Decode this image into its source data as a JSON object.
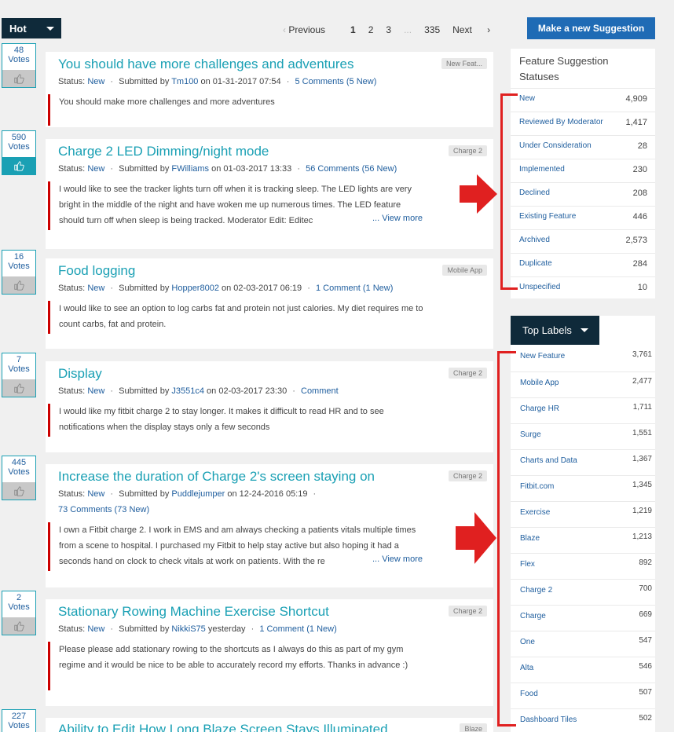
{
  "sort": {
    "label": "Hot"
  },
  "pagination": {
    "previous": "Previous",
    "pages": [
      "1",
      "2",
      "3"
    ],
    "ellipsis": "...",
    "last": "335",
    "next": "Next"
  },
  "suggest_button": "Make a new Suggestion",
  "posts": [
    {
      "votes": "48",
      "votes_label": "Votes",
      "title": "You should have more challenges and adventures",
      "tag": "New Feat...",
      "status_label": "Status:",
      "status": "New",
      "submitted_by": "Submitted by",
      "user": "Tm100",
      "date": "on 01-31-2017 07:54",
      "comments": "5 Comments (5 New)",
      "body": "You should make more challenges and more adventures"
    },
    {
      "votes": "590",
      "votes_label": "Votes",
      "title": "Charge 2 LED Dimming/night mode",
      "tag": "Charge 2",
      "status_label": "Status:",
      "status": "New",
      "submitted_by": "Submitted by",
      "user": "FWilliams",
      "date": "on 01-03-2017 13:33",
      "comments": "56 Comments (56 New)",
      "body": "I would like to see the tracker lights turn off when it is tracking sleep. The LED lights are very bright in the middle of the night and have woken me up numerous times. The LED feature should turn off when sleep is being tracked.    Moderator Edit: Editec",
      "more": "... View more"
    },
    {
      "votes": "16",
      "votes_label": "Votes",
      "title": "Food logging",
      "tag": "Mobile App",
      "status_label": "Status:",
      "status": "New",
      "submitted_by": "Submitted by",
      "user": "Hopper8002",
      "date": "on 02-03-2017 06:19",
      "comments": "1 Comment (1 New)",
      "body": "I would like to see an option to log carbs fat and protein not just calories. My diet requires me to count carbs, fat and protein."
    },
    {
      "votes": "7",
      "votes_label": "Votes",
      "title": "Display",
      "tag": "Charge 2",
      "status_label": "Status:",
      "status": "New",
      "submitted_by": "Submitted by",
      "user": "J3551c4",
      "date": "on 02-03-2017 23:30",
      "comments": "Comment",
      "body": "I would like my fitbit charge 2 to stay longer. It makes it difficult to read HR and to see notifications when the display stays only a few seconds"
    },
    {
      "votes": "445",
      "votes_label": "Votes",
      "title": "Increase the duration of Charge 2's screen staying on",
      "tag": "Charge 2",
      "status_label": "Status:",
      "status": "New",
      "submitted_by": "Submitted by",
      "user": "Puddlejumper",
      "date": "on 12-24-2016 05:19",
      "comments": "73 Comments (73 New)",
      "body": "I own a Fitbit charge 2. I work in EMS and am always checking a patients vitals multiple times from a scene to hospital. I purchased my Fitbit to help stay active but also hoping it had a seconds hand on clock to check vitals at work on patients. With the re",
      "more": "... View more"
    },
    {
      "votes": "2",
      "votes_label": "Votes",
      "title": "Stationary Rowing Machine Exercise Shortcut",
      "tag": "Charge 2",
      "status_label": "Status:",
      "status": "New",
      "submitted_by": "Submitted by",
      "user": "NikkiS75",
      "date": "yesterday",
      "comments": "1 Comment (1 New)",
      "body": "Please please add stationary rowing to the shortcuts as I always do this as part of my gym regime and it would be nice to be able to accurately record my efforts. Thanks in advance :)"
    },
    {
      "votes": "227",
      "votes_label": "Votes",
      "title": "Ability to Edit How Long Blaze Screen Stays Illuminated",
      "tag": "Blaze"
    }
  ],
  "statuses": {
    "title": "Feature Suggestion Statuses",
    "items": [
      {
        "name": "New",
        "count": "4,909"
      },
      {
        "name": "Reviewed By Moderator",
        "count": "1,417"
      },
      {
        "name": "Under Consideration",
        "count": "28"
      },
      {
        "name": "Implemented",
        "count": "230"
      },
      {
        "name": "Declined",
        "count": "208"
      },
      {
        "name": "Existing Feature",
        "count": "446"
      },
      {
        "name": "Archived",
        "count": "2,573"
      },
      {
        "name": "Duplicate",
        "count": "284"
      },
      {
        "name": "Unspecified",
        "count": "10"
      }
    ]
  },
  "labels": {
    "title": "Top Labels",
    "items": [
      {
        "name": "New Feature",
        "count": "3,761"
      },
      {
        "name": "Mobile App",
        "count": "2,477"
      },
      {
        "name": "Charge HR",
        "count": "1,711"
      },
      {
        "name": "Surge",
        "count": "1,551"
      },
      {
        "name": "Charts and Data",
        "count": "1,367"
      },
      {
        "name": "Fitbit.com",
        "count": "1,345"
      },
      {
        "name": "Exercise",
        "count": "1,219"
      },
      {
        "name": "Blaze",
        "count": "1,213"
      },
      {
        "name": "Flex",
        "count": "892"
      },
      {
        "name": "Charge 2",
        "count": "700"
      },
      {
        "name": "Charge",
        "count": "669"
      },
      {
        "name": "One",
        "count": "547"
      },
      {
        "name": "Alta",
        "count": "546"
      },
      {
        "name": "Food",
        "count": "507"
      },
      {
        "name": "Dashboard Tiles",
        "count": "502"
      }
    ]
  },
  "colors": {
    "accent": "#1aa0b4",
    "link": "#1f5e9e",
    "dark": "#0f2a3a",
    "button": "#1f6bb5",
    "annotation": "#e02020"
  }
}
